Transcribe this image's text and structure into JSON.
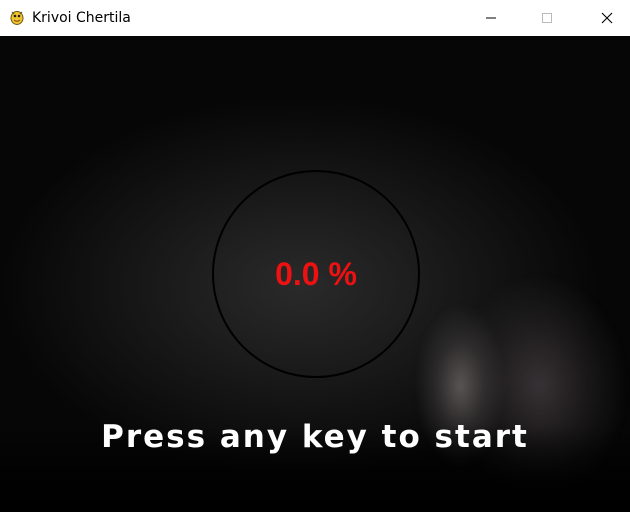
{
  "window": {
    "title": "Krivoi Chertila",
    "app_icon": "pygame-snake-icon",
    "controls": {
      "minimize_icon": "minimize-icon",
      "maximize_icon": "maximize-icon",
      "close_icon": "close-icon"
    }
  },
  "game": {
    "progress_text": "0.0 %",
    "progress_value": 0.0,
    "prompt": "Press any key to start",
    "colors": {
      "progress_text": "#ee1111",
      "prompt_text": "#ffffff",
      "ring": "#000000"
    }
  }
}
